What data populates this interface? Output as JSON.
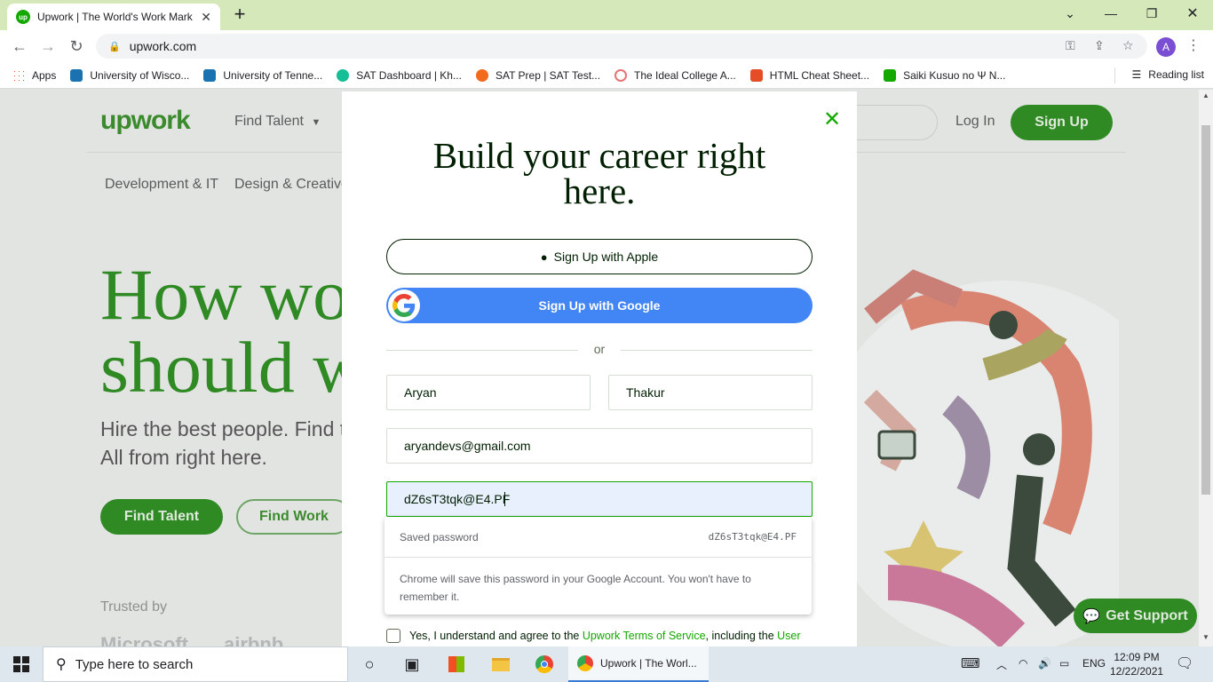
{
  "browser": {
    "tab_title": "Upwork | The World's Work Mark",
    "url": "upwork.com",
    "profile_initial": "A",
    "tab_favicon_text": "up"
  },
  "bookmarks": {
    "apps": "Apps",
    "items": [
      {
        "label": "University of Wisco...",
        "color": "#1a73b0"
      },
      {
        "label": "University of Tenne...",
        "color": "#1a73b0"
      },
      {
        "label": "SAT Dashboard | Kh...",
        "color": "#14bf96"
      },
      {
        "label": "SAT Prep | SAT Test...",
        "color": "#f26b1d"
      },
      {
        "label": "The Ideal College A...",
        "color": "#e57373"
      },
      {
        "label": "HTML Cheat Sheet...",
        "color": "#e44d26"
      },
      {
        "label": "Saiki Kusuo no Ψ N...",
        "color": "#14a800"
      }
    ],
    "reading_list": "Reading list"
  },
  "page": {
    "logo": "upwork",
    "nav": {
      "find_talent": "Find Talent",
      "login": "Log In",
      "signup": "Sign Up"
    },
    "categories": [
      "Development & IT",
      "Design & Creative"
    ],
    "hero_title_line1": "How wo",
    "hero_title_line2": "should w",
    "hero_sub_line1": "Hire the best people. Find t",
    "hero_sub_line2": "All from right here.",
    "btn_find_talent": "Find Talent",
    "btn_find_work": "Find Work",
    "trusted": "Trusted by",
    "brands": [
      "Microsoft",
      "airbnb"
    ],
    "support": "Get Support"
  },
  "modal": {
    "title": "Build your career right here.",
    "apple_button": "Sign Up with Apple",
    "google_button": "Sign Up with Google",
    "or": "or",
    "first_name": "Aryan",
    "last_name": "Thakur",
    "email": "aryandevs@gmail.com",
    "password": "dZ6sT3tqk@E4.PF",
    "password_popup": {
      "label": "Saved password",
      "value": "dZ6sT3tqk@E4.PF",
      "note": "Chrome will save this password in your Google Account. You won't have to remember it."
    },
    "terms_prefix": "Yes, I understand and agree to the ",
    "terms_link": "Upwork Terms of Service",
    "terms_middle": ", including the ",
    "terms_link2": "User"
  },
  "taskbar": {
    "search_placeholder": "Type here to search",
    "active_window": "Upwork | The Worl...",
    "language": "ENG",
    "time": "12:09 PM",
    "date": "12/22/2021"
  },
  "colors": {
    "upwork_green": "#14a800",
    "google_blue": "#4285f4"
  }
}
